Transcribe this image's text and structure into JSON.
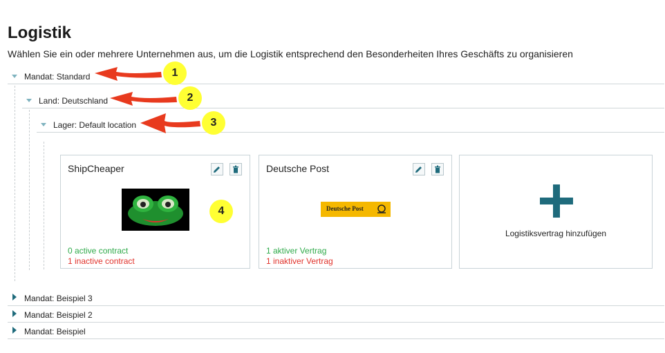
{
  "header": {
    "title": "Logistik",
    "subtitle": "Wählen Sie ein oder mehrere Unternehmen aus, um die Logistik entsprechend den Besonderheiten Ihres Geschäfts zu organisieren"
  },
  "tree": {
    "mandat": "Mandat: Standard",
    "land": "Land: Deutschland",
    "lager": "Lager: Default location",
    "collapsed": [
      "Mandat: Beispiel 3",
      "Mandat: Beispiel 2",
      "Mandat: Beispiel"
    ]
  },
  "cards": [
    {
      "name": "ShipCheaper",
      "active": "0 active contract",
      "inactive": "1 inactive contract",
      "logo": "frog-logo"
    },
    {
      "name": "Deutsche Post",
      "active": "1 aktiver Vertrag",
      "inactive": "1 inaktiver Vertrag",
      "logo": "deutsche-post-logo",
      "logo_text": "Deutsche Post"
    }
  ],
  "add_card": {
    "label": "Logistiksvertrag hinzufügen",
    "icon": "plus-icon"
  },
  "annotations": [
    "1",
    "2",
    "3",
    "4"
  ],
  "colors": {
    "accent": "#1f6b7c",
    "active": "#2eaa4a",
    "inactive": "#e0322b",
    "badge": "#ffff33",
    "arrow": "#e83a1e"
  }
}
